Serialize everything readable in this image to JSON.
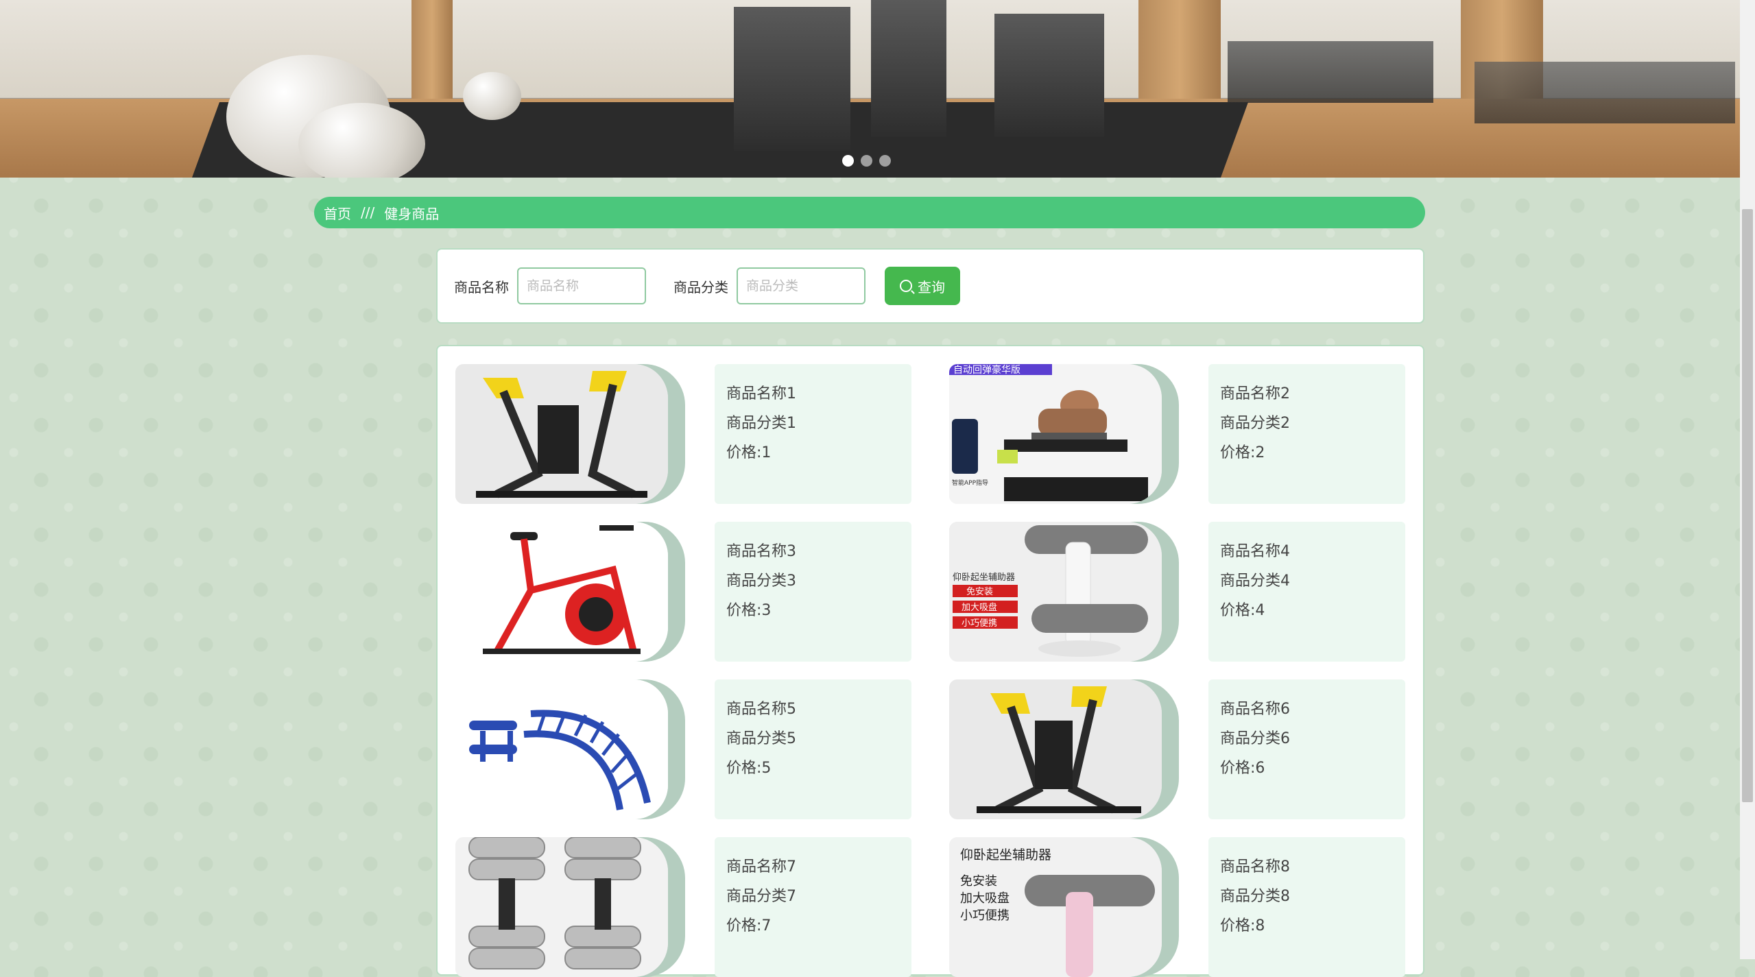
{
  "banner": {
    "slide_count": 3,
    "active_slide": 1,
    "colors": {
      "wood": "#c79866",
      "mat": "#2b2b2b",
      "wall": "#e8e4dc"
    }
  },
  "breadcrumb": {
    "home": "首页",
    "separator": "///",
    "current": "健身商品"
  },
  "search": {
    "name_label": "商品名称",
    "name_placeholder": "商品名称",
    "name_value": "",
    "category_label": "商品分类",
    "category_placeholder": "商品分类",
    "category_value": "",
    "button_label": "查询",
    "button_icon": "search-icon"
  },
  "products": [
    {
      "name": "商品名称1",
      "category": "商品分类1",
      "price": "价格:1",
      "image": "chest-press-machine"
    },
    {
      "name": "商品名称2",
      "category": "商品分类2",
      "price": "价格:2",
      "image": "sit-up-bench",
      "image_text": "自动回弹豪华版",
      "image_caption": "智能APP指导"
    },
    {
      "name": "商品名称3",
      "category": "商品分类3",
      "price": "价格:3",
      "image": "spin-bike"
    },
    {
      "name": "商品名称4",
      "category": "商品分类4",
      "price": "价格:4",
      "image": "sit-up-assist",
      "image_lines": [
        "仰卧起坐辅助器",
        "免安装",
        "加大吸盘",
        "小巧便携"
      ]
    },
    {
      "name": "商品名称5",
      "category": "商品分类5",
      "price": "价格:5",
      "image": "outdoor-back-stretcher"
    },
    {
      "name": "商品名称6",
      "category": "商品分类6",
      "price": "价格:6",
      "image": "chest-press-machine"
    },
    {
      "name": "商品名称7",
      "category": "商品分类7",
      "price": "价格:7",
      "image": "dumbbells"
    },
    {
      "name": "商品名称8",
      "category": "商品分类8",
      "price": "价格:8",
      "image": "sit-up-assist-pink",
      "image_lines": [
        "仰卧起坐辅助器",
        "免安装",
        "加大吸盘",
        "小巧便携"
      ]
    }
  ],
  "colors": {
    "breadcrumb_bg": "#4bc77c",
    "button_bg": "#45b84e",
    "info_bg": "#ecf8f1",
    "thumb_shadow": "#b4cdbf"
  }
}
